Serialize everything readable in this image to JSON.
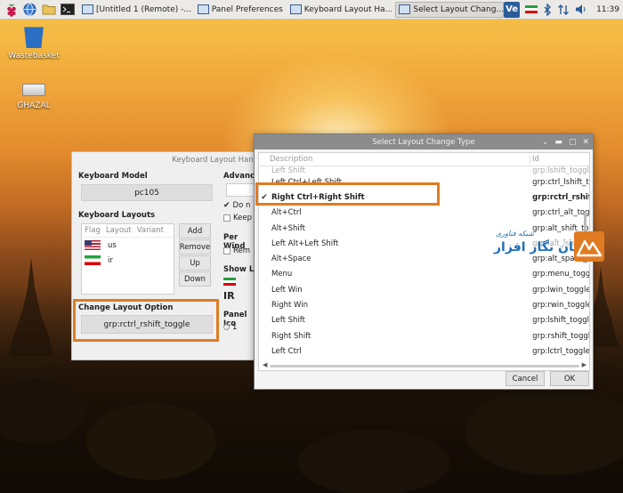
{
  "taskbar": {
    "tasks": [
      {
        "label": "[Untitled 1 (Remote) -..."
      },
      {
        "label": "Panel Preferences"
      },
      {
        "label": "Keyboard Layout Ha..."
      },
      {
        "label": "Select Layout Chang..."
      }
    ],
    "vnc_label": "Ve",
    "clock": "11:39"
  },
  "desktop": {
    "icons": [
      {
        "label": "Wastebasket"
      },
      {
        "label": "GHAZAL"
      }
    ]
  },
  "keyboard_window": {
    "title": "Keyboard Layout Hand",
    "model_label": "Keyboard Model",
    "model_value": "pc105",
    "layouts_label": "Keyboard Layouts",
    "columns": [
      "Flag",
      "Layout",
      "Variant"
    ],
    "layouts": [
      {
        "layout": "us"
      },
      {
        "layout": "ir"
      }
    ],
    "buttons": {
      "add": "Add",
      "remove": "Remove",
      "up": "Up",
      "down": "Down"
    },
    "change_label": "Change Layout Option",
    "change_value": "grp:rctrl_rshift_toggle",
    "advanced_label": "Advance",
    "do_label": "Do n",
    "keep_label": "Keep",
    "per_window_label": "Per Wind",
    "rem_label": "Rem",
    "show_label": "Show La",
    "ir_label": "IR",
    "panel_icon_label": "Panel Ico",
    "radio_1": "1"
  },
  "dialog": {
    "title": "Select Layout Change Type",
    "col_description": "Description",
    "col_id": "Id",
    "top_partial_desc": "Left Shift",
    "top_partial_id": "grp:lshift_toggl",
    "rows": [
      {
        "desc": "Left Ctrl+Left Shift",
        "id": "grp:ctrl_lshift_tog",
        "checked": ""
      },
      {
        "desc": "Right Ctrl+Right Shift",
        "id": "grp:rctrl_rshift_t",
        "checked": "✔"
      },
      {
        "desc": "Alt+Ctrl",
        "id": "grp:ctrl_alt_toggle",
        "checked": ""
      },
      {
        "desc": "Alt+Shift",
        "id": "grp:alt_shift_togg",
        "checked": ""
      },
      {
        "desc": "Left Alt+Left Shift",
        "id": "grp:lalt_lshift_tog",
        "checked": ""
      },
      {
        "desc": "Alt+Space",
        "id": "grp:alt_space_tog",
        "checked": ""
      },
      {
        "desc": "Menu",
        "id": "grp:menu_toggle",
        "checked": ""
      },
      {
        "desc": "Left Win",
        "id": "grp:lwin_toggle",
        "checked": ""
      },
      {
        "desc": "Right Win",
        "id": "grp:rwin_toggle",
        "checked": ""
      },
      {
        "desc": "Left Shift",
        "id": "grp:lshift_toggle",
        "checked": ""
      },
      {
        "desc": "Right Shift",
        "id": "grp:rshift_toggle",
        "checked": ""
      },
      {
        "desc": "Left Ctrl",
        "id": "grp:lctrl_toggle",
        "checked": ""
      }
    ],
    "cancel_label": "Cancel",
    "ok_label": "OK"
  },
  "watermark": {
    "top": "شبکه فناوری",
    "main": "مهان نگار افزار"
  },
  "colors": {
    "highlight_box": "#e07b22",
    "taskbar_bg": "#eceae6",
    "dialog_title_bg": "#8c8c8c"
  }
}
